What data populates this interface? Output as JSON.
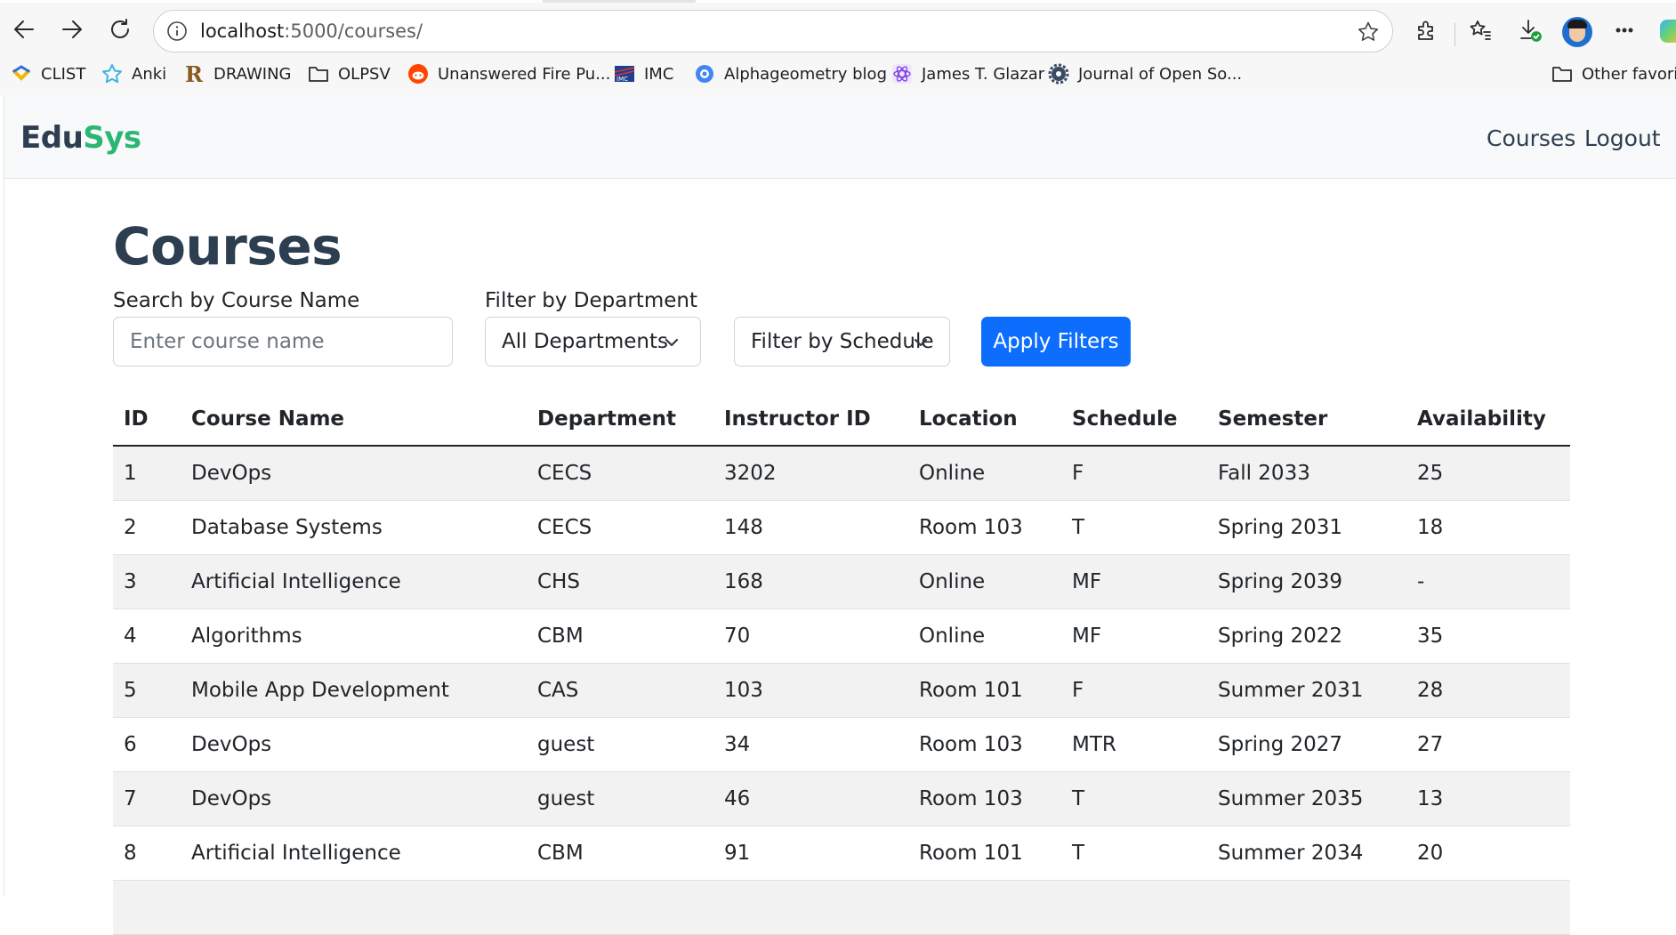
{
  "browser": {
    "url_host": "localhost",
    "url_rest": ":5000/courses/",
    "bookmarks": [
      {
        "label": "CLIST",
        "icon": "clist-icon"
      },
      {
        "label": "Anki",
        "icon": "anki-star-icon"
      },
      {
        "label": "DRAWING",
        "icon": "r-letter-icon"
      },
      {
        "label": "OLPSV",
        "icon": "folder-icon"
      },
      {
        "label": "Unanswered Fire Pu...",
        "icon": "reddit-icon"
      },
      {
        "label": "IMC",
        "icon": "imc-icon"
      },
      {
        "label": "Alphageometry blog",
        "icon": "blog-icon"
      },
      {
        "label": "James T. Glazar",
        "icon": "react-icon"
      },
      {
        "label": "Journal of Open So...",
        "icon": "gear-icon"
      }
    ],
    "other_favorites": "Other favorite"
  },
  "navbar": {
    "brand_part1": "Edu",
    "brand_part2": "Sys",
    "links": [
      "Courses",
      "Logout"
    ],
    "brand_colors": {
      "primary": "#2c3e50",
      "accent": "#2bb673"
    }
  },
  "page": {
    "title": "Courses",
    "filters": {
      "search_label": "Search by Course Name",
      "search_placeholder": "Enter course name",
      "department_label": "Filter by Department",
      "department_selected": "All Departments",
      "schedule_selected": "Filter by Schedule",
      "apply_label": "Apply Filters",
      "apply_color": "#0d6efd"
    },
    "table": {
      "columns": [
        "ID",
        "Course Name",
        "Department",
        "Instructor ID",
        "Location",
        "Schedule",
        "Semester",
        "Availability"
      ],
      "rows": [
        [
          "1",
          "DevOps",
          "CECS",
          "3202",
          "Online",
          "F",
          "Fall 2033",
          "25"
        ],
        [
          "2",
          "Database Systems",
          "CECS",
          "148",
          "Room 103",
          "T",
          "Spring 2031",
          "18"
        ],
        [
          "3",
          "Artificial Intelligence",
          "CHS",
          "168",
          "Online",
          "MF",
          "Spring 2039",
          "-"
        ],
        [
          "4",
          "Algorithms",
          "CBM",
          "70",
          "Online",
          "MF",
          "Spring 2022",
          "35"
        ],
        [
          "5",
          "Mobile App Development",
          "CAS",
          "103",
          "Room 101",
          "F",
          "Summer 2031",
          "28"
        ],
        [
          "6",
          "DevOps",
          "guest",
          "34",
          "Room 103",
          "MTR",
          "Spring 2027",
          "27"
        ],
        [
          "7",
          "DevOps",
          "guest",
          "46",
          "Room 103",
          "T",
          "Summer 2035",
          "13"
        ],
        [
          "8",
          "Artificial Intelligence",
          "CBM",
          "91",
          "Room 101",
          "T",
          "Summer 2034",
          "20"
        ]
      ]
    }
  }
}
